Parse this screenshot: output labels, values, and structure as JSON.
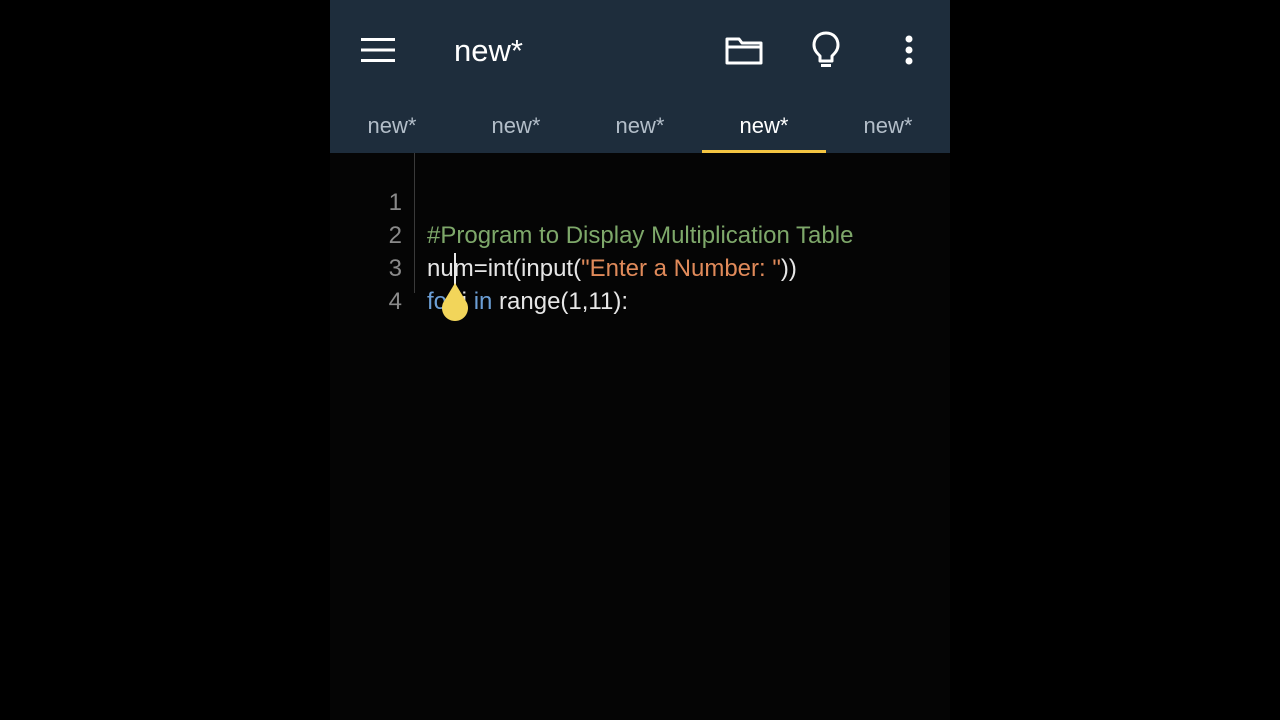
{
  "app_bar": {
    "title": "new*",
    "icons": {
      "menu": "hamburger-menu-icon",
      "folder": "folder-icon",
      "bulb": "lightbulb-icon",
      "more": "more-vertical-icon"
    }
  },
  "tabs": [
    {
      "label": "new*",
      "active": false
    },
    {
      "label": "new*",
      "active": false
    },
    {
      "label": "new*",
      "active": false
    },
    {
      "label": "new*",
      "active": true
    },
    {
      "label": "new*",
      "active": false
    }
  ],
  "editor": {
    "lines": [
      {
        "number": "1",
        "tokens": [
          {
            "type": "comment",
            "text": "#Program to Display Multiplication Table"
          }
        ]
      },
      {
        "number": "2",
        "tokens": [
          {
            "type": "plain",
            "text": "num=int(input("
          },
          {
            "type": "string",
            "text": "\"Enter a Number: \""
          },
          {
            "type": "plain",
            "text": "))"
          }
        ]
      },
      {
        "number": "3",
        "tokens": [
          {
            "type": "keyword",
            "text": "for"
          },
          {
            "type": "plain",
            "text": " i "
          },
          {
            "type": "keyword",
            "text": "in"
          },
          {
            "type": "plain",
            "text": " range(1,11):"
          }
        ]
      },
      {
        "number": "4",
        "tokens": []
      }
    ]
  },
  "colors": {
    "app_bar_bg": "#1e2d3c",
    "tab_indicator": "#f4c542",
    "comment": "#7ea86a",
    "string": "#e08a5a",
    "keyword": "#6c9fd6",
    "cursor_handle": "#f2d55a"
  }
}
